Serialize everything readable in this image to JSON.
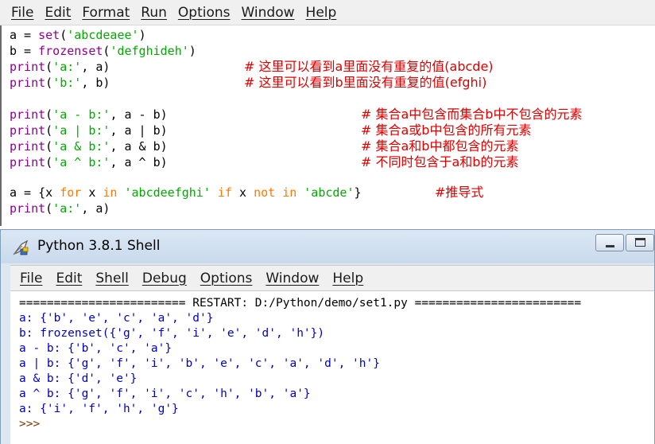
{
  "editor": {
    "menu": [
      "File",
      "Edit",
      "Format",
      "Run",
      "Options",
      "Window",
      "Help"
    ],
    "code": {
      "l1": "a = set('abcdeaee')",
      "l2": "b = frozenset('defghideh')",
      "l3": "print('a:', a)",
      "l4": "print('b:', b)",
      "l5": "print('a - b:', a - b)",
      "l6": "print('a | b:', a | b)",
      "l7": "print('a & b:', a & b)",
      "l8": "print('a ^ b:', a ^ b)",
      "l9": "a = {x for x in 'abcdeefghi' if x not in 'abcde'}",
      "l9c": "#推导式",
      "l10": "print('a:', a)"
    },
    "comments": {
      "c3": "# 这里可以看到a里面没有重复的值(abcde)",
      "c4": "# 这里可以看到b里面没有重复的值(efghi)",
      "c5": "# 集合a中包含而集合b中不包含的元素",
      "c6": "# 集合a或b中包含的所有元素",
      "c7": "# 集合a和b中都包含的元素",
      "c8": "# 不同时包含于a和b的元素"
    }
  },
  "shell": {
    "title": "Python 3.8.1 Shell",
    "menu": [
      "File",
      "Edit",
      "Shell",
      "Debug",
      "Options",
      "Window",
      "Help"
    ],
    "output": {
      "o0": "'''",
      "o1": "======================== RESTART: D:/Python/demo/set1.py ========================",
      "o2": "a: {'b', 'e', 'c', 'a', 'd'}",
      "o3": "b: frozenset({'g', 'f', 'i', 'e', 'd', 'h'})",
      "o4": "a - b: {'b', 'c', 'a'}",
      "o5": "a | b: {'g', 'f', 'i', 'b', 'e', 'c', 'a', 'd', 'h'}",
      "o6": "a & b: {'d', 'e'}",
      "o7": "a ^ b: {'g', 'f', 'i', 'c', 'h', 'b', 'a'}",
      "o8": "a: {'i', 'f', 'h', 'g'}",
      "prompt": ">>>"
    }
  },
  "colors": {
    "comment": "#dd0000",
    "builtin": "#900090",
    "keyword": "#ff7700",
    "string": "#00aa00",
    "stdout": "#0000cc"
  }
}
